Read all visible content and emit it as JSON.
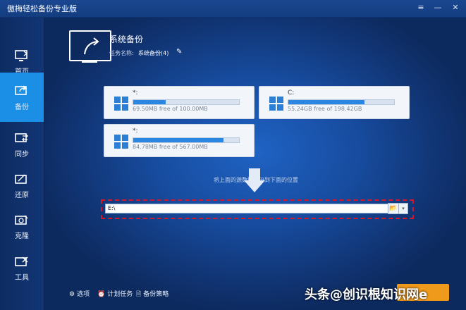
{
  "window": {
    "title": "傲梅轻松备份专业版",
    "menu_icon": "≡",
    "min_icon": "—",
    "close_icon": "✕"
  },
  "sidebar": {
    "items": [
      {
        "label": "首页",
        "icon": "home-monitor-icon",
        "active": false
      },
      {
        "label": "备份",
        "icon": "backup-icon",
        "active": true
      },
      {
        "label": "同步",
        "icon": "sync-icon",
        "active": false
      },
      {
        "label": "还原",
        "icon": "restore-icon",
        "active": false
      },
      {
        "label": "克隆",
        "icon": "clone-icon",
        "active": false
      },
      {
        "label": "工具",
        "icon": "tools-icon",
        "active": false
      }
    ]
  },
  "header": {
    "title": "系统备份",
    "task_name_label": "任务名称:",
    "task_name_value": "系统备份(4)",
    "edit_icon": "✎"
  },
  "disks": [
    {
      "name": "*:",
      "info": "69.50MB free of 100.00MB",
      "used_fraction": 0.305
    },
    {
      "name": "C:",
      "info": "55.24GB free of 198.42GB",
      "used_fraction": 0.72
    },
    {
      "name": "*:",
      "info": "84.78MB free of 567.00MB",
      "used_fraction": 0.85
    }
  ],
  "hint": "将上面的源数据备份到下面的位置",
  "destination": {
    "value": "E:\\",
    "folder_icon": "📂",
    "dropdown_icon": "▾"
  },
  "bottom": {
    "options": "选项",
    "schedule": "计划任务",
    "strategy": "备份策略",
    "options_icon": "⚙",
    "schedule_icon": "⏰",
    "strategy_icon": "🗎"
  },
  "watermark": "头条@创识根知识网e",
  "colors": {
    "accent": "#1b8ee6",
    "start": "#f09a1c",
    "highlight": "#d4172e"
  }
}
